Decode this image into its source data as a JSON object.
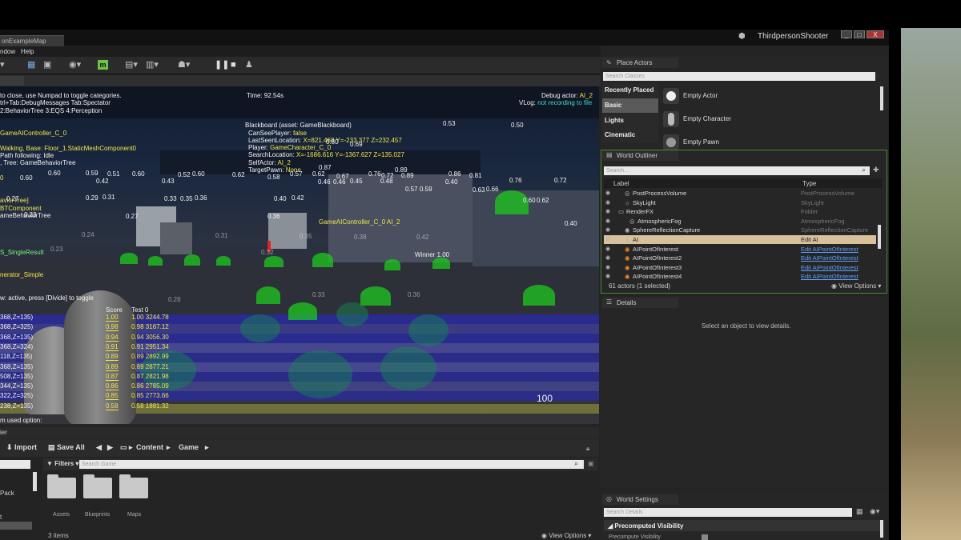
{
  "window": {
    "tab_title": "onExampleMap",
    "app_title": "ThirdpersonShooter",
    "min": "_",
    "max": "□",
    "close": "X"
  },
  "menu": {
    "item1": "ndow",
    "item2": "Help"
  },
  "viewport": {
    "help_line1": "to close, use Numpad to toggle categories.",
    "help_line1_hl": "Numpad",
    "help_line2": "trl+Tab:DebugMessages  Tab:Spectator",
    "help_line3": "2:BehaviorTree  3:EQS  4:Perception",
    "time": "Time: 92.54s",
    "debug_actor_label": "Debug actor: ",
    "debug_actor": "AI_2",
    "vlog_label": "VLog: ",
    "vlog": "not recording to file",
    "controller": "GameAIController_C_0",
    "walking": "Walking, Base: Floor_1.StaticMeshComponent0",
    "path": "Path following: Idle",
    "tree": ", Tree: GameBehaviorTree",
    "zero": "0",
    "bt1": "aviorTree]",
    "bt2": "BTComponent",
    "bt3": "ameBehaviorTree",
    "eqs1": "S_SingleResult",
    "eqs2": "nerator_Simple",
    "press_divide": "w: active, press [Divide] to toggle",
    "last_option": "m used option:",
    "big_num": "100",
    "blackboard": {
      "title": "Blackboard (asset: GameBlackboard)",
      "can_see_k": "CanSeePlayer: ",
      "can_see_v": "false",
      "last_seen_k": "LastSeenLocation: ",
      "last_seen_v": "X=821.468 Y=-233.377 Z=232.457",
      "player_k": "Player: ",
      "player_v": "GameCharacter_C_0",
      "search_k": "SearchLocation: ",
      "search_v": "X=-1686.616 Y=-1367.627 Z=135.027",
      "self_k": "SelfActor: ",
      "self_v": "AI_2",
      "target_k": "TargetPawn: ",
      "target_v": "None"
    },
    "ai_label": "GameAIController_C_0 AI_2",
    "winner": "Winner 1.00",
    "score_hdr": "Score",
    "test_hdr": "Test 0",
    "score_rows": [
      {
        "loc": "368,Z=135)",
        "score": "1.00",
        "test": "1.00 3244.78"
      },
      {
        "loc": "368,Z=325)",
        "score": "0.98",
        "test": "0.98 3167.12"
      },
      {
        "loc": "368,Z=135)",
        "score": "0.94",
        "test": "0.94 3056.30"
      },
      {
        "loc": "368,Z=324)",
        "score": "0.91",
        "test": "0.91 2951.34"
      },
      {
        "loc": "118,Z=135)",
        "score": "0.89",
        "test": "0.89 2892.99"
      },
      {
        "loc": "368,Z=135)",
        "score": "0.89",
        "test": "0.89 2877.21"
      },
      {
        "loc": "508,Z=135)",
        "score": "0.87",
        "test": "0.87 2821.98"
      },
      {
        "loc": "344,Z=135)",
        "score": "0.86",
        "test": "0.86 2785.09"
      },
      {
        "loc": "322,Z=325)",
        "score": "0.85",
        "test": "0.85 2773.66"
      },
      {
        "loc": "238,Z=135)",
        "score": "0.58",
        "test": "0.58 1881.32"
      }
    ],
    "point_labels": [
      "0.53",
      "0.50",
      "0.80",
      "0.69",
      "0.89",
      "0.87",
      "0.60",
      "0.59",
      "0.51",
      "0.60",
      "0.52",
      "0.60",
      "0.62",
      "0.58",
      "0.57",
      "0.62",
      "0.67",
      "0.76",
      "0.72",
      "0.89",
      "0.86",
      "0.81",
      "0.76",
      "0.72",
      "0.42",
      "0.43",
      "0.45",
      "0.48",
      "0.40",
      "0.46",
      "0.46",
      "0.57",
      "0.59",
      "0.63",
      "0.66",
      "0.60",
      "0.62",
      "0.33",
      "0.35",
      "0.36",
      "0.40",
      "0.42",
      "0.27",
      "0.29",
      "0.31",
      "0.23",
      "0.27",
      "0.24",
      "0.31",
      "0.35",
      "0.38",
      "0.42",
      "0.40",
      "0.23",
      "0.32",
      "0.33",
      "0.36",
      "0.28",
      "0.36",
      "0.60"
    ]
  },
  "place_actors": {
    "title": "Place Actors",
    "search": "Search Classes",
    "categories": [
      "Recently Placed",
      "Basic",
      "Lights",
      "Cinematic"
    ],
    "items": [
      "Empty Actor",
      "Empty Character",
      "Empty Pawn"
    ]
  },
  "outliner": {
    "title": "World Outliner",
    "search": "Search...",
    "col_label": "Label",
    "col_type": "Type",
    "rows": [
      {
        "label": "PostProcessVolume",
        "type": "PostProcessVolume"
      },
      {
        "label": "SkyLight",
        "type": "SkyLight"
      },
      {
        "label": "RenderFX",
        "type": "Folder"
      },
      {
        "label": "AtmosphericFog",
        "type": "AtmosphericFog"
      },
      {
        "label": "SphereReflectionCapture",
        "type": "SphereReflectionCapture"
      },
      {
        "label": "AI",
        "type": "Edit AI"
      },
      {
        "label": "AIPointOfInterest",
        "type": "Edit AIPointOfInterest"
      },
      {
        "label": "AIPointOfInterest2",
        "type": "Edit AIPointOfInterest"
      },
      {
        "label": "AIPointOfInterest3",
        "type": "Edit AIPointOfInterest"
      },
      {
        "label": "AIPointOfInterest4",
        "type": "Edit AIPointOfInterest"
      }
    ],
    "count": "61 actors (1 selected)",
    "view_options": "View Options"
  },
  "details": {
    "title": "Details",
    "empty": "Select an object to view details."
  },
  "world_settings": {
    "title": "World Settings",
    "search": "Search Details",
    "section": "Precomputed Visibility",
    "row": "Precompute Visibility"
  },
  "content_browser": {
    "tab": "ier",
    "import": "Import",
    "save_all": "Save All",
    "content": "Content",
    "game": "Game",
    "filters": "Filters",
    "search": "Search Game",
    "left_item1": "Pack",
    "left_item2": "t",
    "folders": [
      "Assets",
      "Blueprints",
      "Maps"
    ],
    "count": "3 items",
    "view_options": "View Options"
  }
}
